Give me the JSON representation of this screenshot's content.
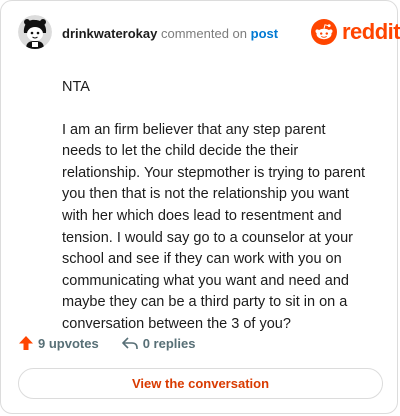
{
  "header": {
    "username": "drinkwaterokay",
    "action_text": "commented on",
    "post_link": "post",
    "logo_text": "reddit"
  },
  "comment": {
    "paragraphs": [
      "NTA",
      "I am an firm believer that any step parent needs to let the child decide the their relationship. Your stepmother is trying to parent you then that is not the relationship you want with her which does lead to resentment and tension. I would say go to a counselor at your school and see if they can work with you on communicating what you want and need and maybe they can be a third party to sit in on a conversation between the 3 of you?"
    ]
  },
  "actions": {
    "upvotes_label": "9 upvotes",
    "replies_label": "0 replies"
  },
  "cta": {
    "label": "View the conversation"
  },
  "colors": {
    "brand": "#ff4500",
    "link": "#0079d3",
    "cta_text": "#d93a00",
    "muted": "#576f76"
  },
  "icons": [
    "avatar",
    "reddit-snoo-icon",
    "upvote-arrow-icon",
    "reply-arrow-icon"
  ]
}
